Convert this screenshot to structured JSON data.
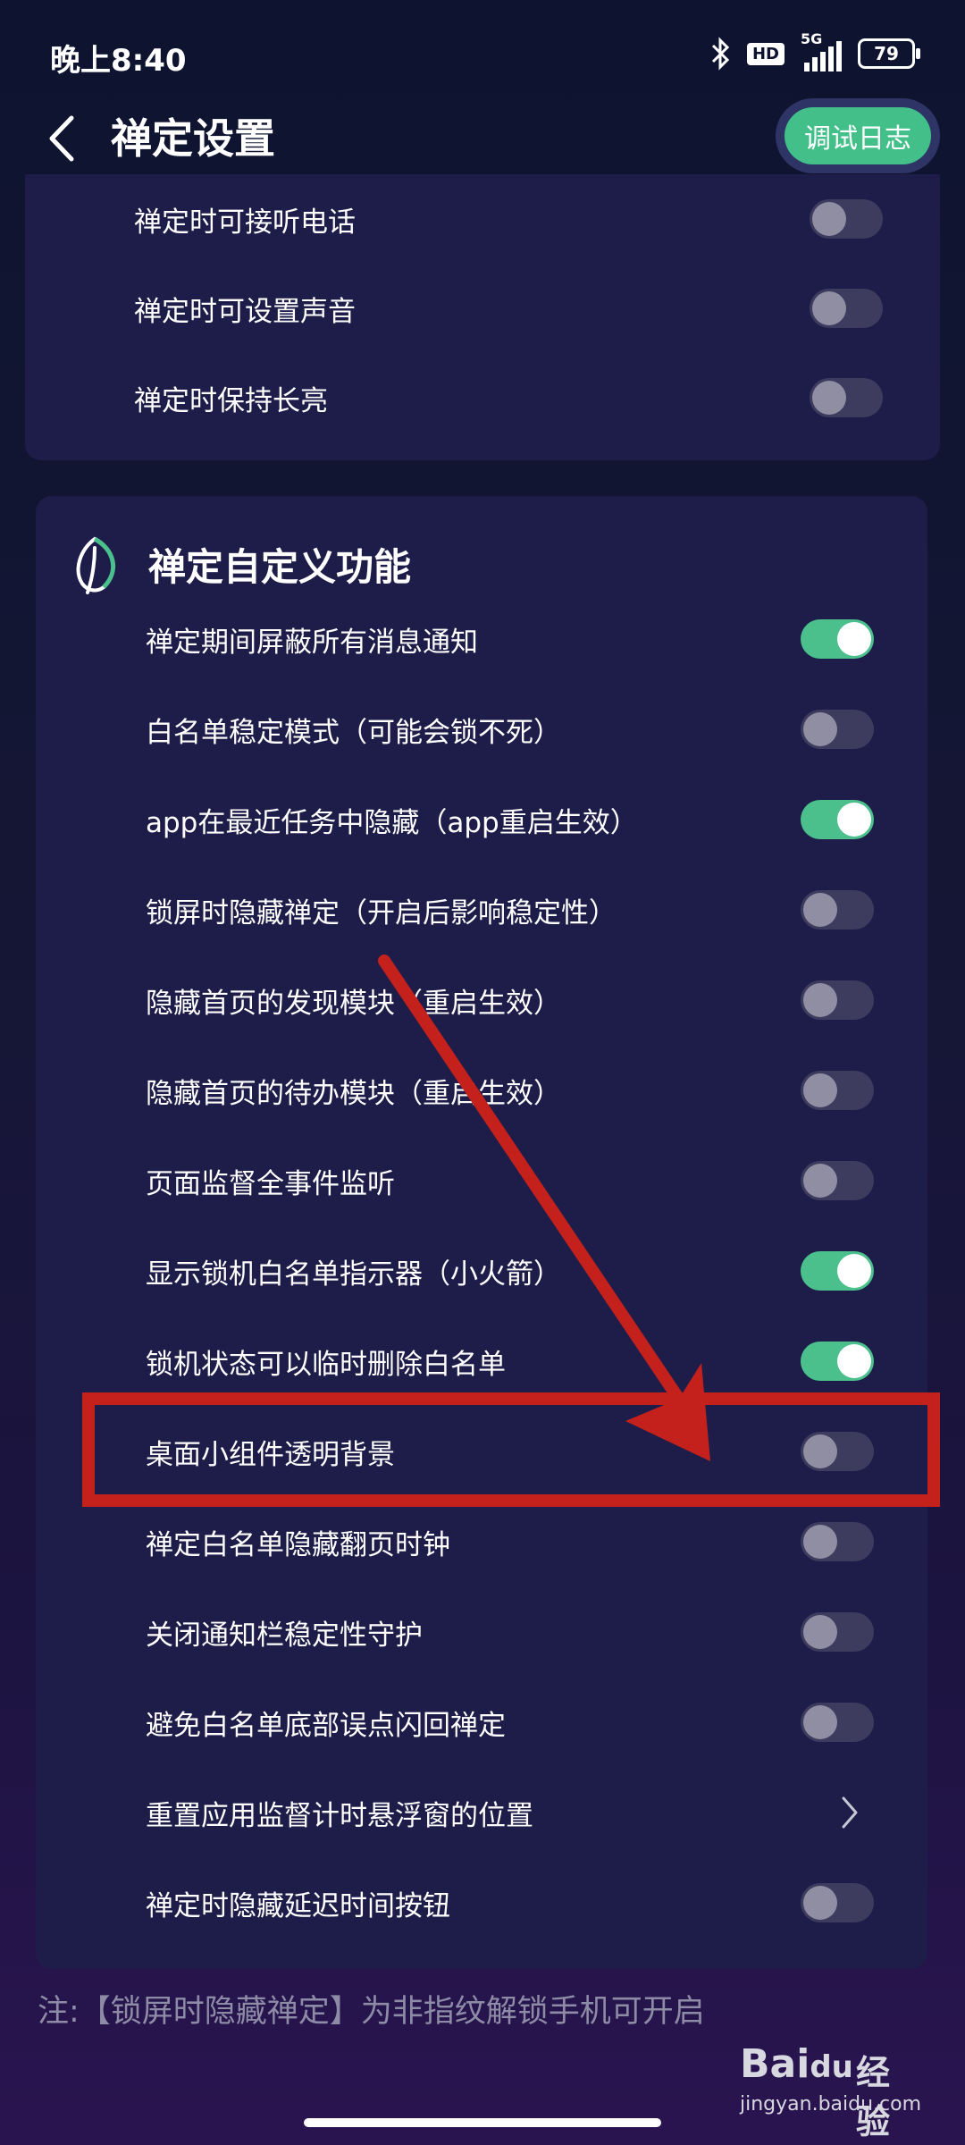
{
  "status_bar": {
    "time": "晚上8:40",
    "hd": "HD",
    "network": "5G",
    "battery": "79"
  },
  "header": {
    "title": "禅定设置",
    "log_button": "调试日志",
    "back_icon": "chevron-left-icon"
  },
  "basic_card": {
    "items": [
      {
        "label": "禅定时可接听电话",
        "on": false
      },
      {
        "label": "禅定时可设置声音",
        "on": false
      },
      {
        "label": "禅定时保持长亮",
        "on": false
      }
    ]
  },
  "custom_card": {
    "title": "禅定自定义功能",
    "icon": "leaf-icon",
    "items": [
      {
        "label": "禅定期间屏蔽所有消息通知",
        "on": true
      },
      {
        "label": "白名单稳定模式（可能会锁不死）",
        "on": false
      },
      {
        "label": "app在最近任务中隐藏（app重启生效）",
        "on": true
      },
      {
        "label": "锁屏时隐藏禅定（开启后影响稳定性）",
        "on": false
      },
      {
        "label": "隐藏首页的发现模块（重启生效）",
        "on": false
      },
      {
        "label": "隐藏首页的待办模块（重启生效）",
        "on": false
      },
      {
        "label": "页面监督全事件监听",
        "on": false
      },
      {
        "label": "显示锁机白名单指示器（小火箭）",
        "on": true
      },
      {
        "label": "锁机状态可以临时删除白名单",
        "on": true
      },
      {
        "label": "桌面小组件透明背景",
        "on": false
      },
      {
        "label": "禅定白名单隐藏翻页时钟",
        "on": false
      },
      {
        "label": "关闭通知栏稳定性守护",
        "on": false
      },
      {
        "label": "避免白名单底部误点闪回禅定",
        "on": false
      },
      {
        "label": "重置应用监督计时悬浮窗的位置",
        "type": "link"
      },
      {
        "label": "禅定时隐藏延迟时间按钮",
        "on": false
      }
    ]
  },
  "footnote": "注:【锁屏时隐藏禅定】为非指纹解锁手机可开启",
  "watermark": {
    "logo": "Bai",
    "paw": "du",
    "cn": "经验",
    "url": "jingyan.baidu.com"
  },
  "colors": {
    "toggle_on": "#4bc08d",
    "toggle_off": "#3d3c5e",
    "annotation": "#c4211c",
    "card": "#1e1d4a"
  }
}
